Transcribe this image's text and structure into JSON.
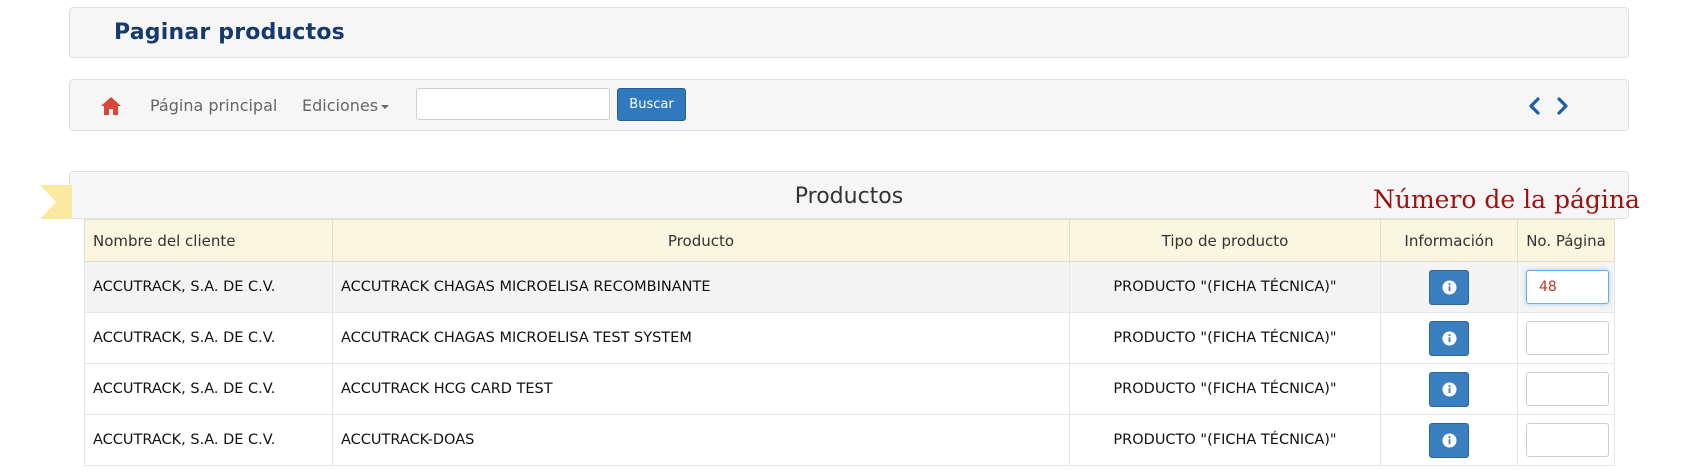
{
  "header": {
    "title": "Paginar productos"
  },
  "nav": {
    "home_icon": "home-icon",
    "links": [
      "Página principal",
      "Ediciones"
    ],
    "search": {
      "value": "",
      "placeholder": "",
      "button_label": "Buscar"
    },
    "pager": {
      "prev_icon": "chevron-left-icon",
      "next_icon": "chevron-right-icon"
    }
  },
  "section": {
    "title": "Productos"
  },
  "annotation": {
    "label": "Número de la página",
    "color": "#9c1111",
    "arrow_color": "#14918a"
  },
  "table": {
    "columns": [
      "Nombre del cliente",
      "Producto",
      "Tipo de producto",
      "Información",
      "No. Página"
    ],
    "rows": [
      {
        "cliente": "ACCUTRACK, S.A. DE C.V.",
        "producto": "ACCUTRACK CHAGAS MICROELISA RECOMBINANTE",
        "tipo": "PRODUCTO \"(FICHA TÉCNICA)\"",
        "pagina": "48"
      },
      {
        "cliente": "ACCUTRACK, S.A. DE C.V.",
        "producto": "ACCUTRACK CHAGAS MICROELISA TEST SYSTEM",
        "tipo": "PRODUCTO \"(FICHA TÉCNICA)\"",
        "pagina": ""
      },
      {
        "cliente": "ACCUTRACK, S.A. DE C.V.",
        "producto": "ACCUTRACK HCG CARD TEST",
        "tipo": "PRODUCTO \"(FICHA TÉCNICA)\"",
        "pagina": ""
      },
      {
        "cliente": "ACCUTRACK, S.A. DE C.V.",
        "producto": "ACCUTRACK-DOAS",
        "tipo": "PRODUCTO \"(FICHA TÉCNICA)\"",
        "pagina": ""
      }
    ]
  },
  "colors": {
    "header_title": "#163a6b",
    "primary_button": "#3079bd",
    "table_header_bg": "#fbf6df",
    "home_icon": "#d9473a"
  }
}
